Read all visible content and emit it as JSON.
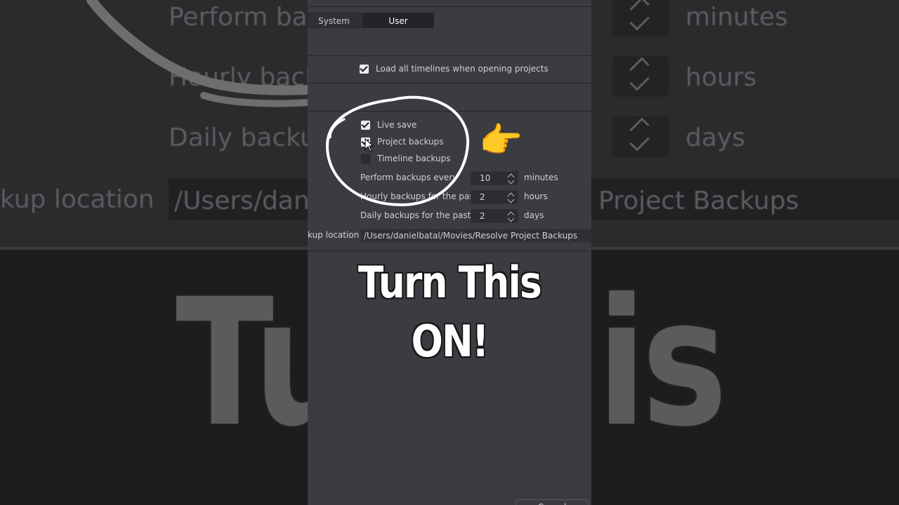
{
  "background": {
    "rows": [
      {
        "label": "Perform bac",
        "unit": "minutes"
      },
      {
        "label": "Hourly back",
        "unit": "hours"
      },
      {
        "label": "Daily backu",
        "unit": "days"
      }
    ],
    "location_label": "kup location",
    "path_left": "/Users/dan",
    "path_right": "Project Backups",
    "huge_left": "Tu",
    "huge_right": "is"
  },
  "tabs": {
    "system": "System",
    "user": "User"
  },
  "load_timelines": {
    "label": "Load all timelines when opening projects",
    "checked": true
  },
  "live_save": {
    "label": "Live save",
    "checked": true
  },
  "project_backups": {
    "label": "Project backups",
    "checked": true
  },
  "timeline_backups": {
    "label": "Timeline backups",
    "checked": false
  },
  "perform_every": {
    "label": "Perform backups every",
    "value": "10",
    "unit": "minutes"
  },
  "hourly": {
    "label": "Hourly backups for the past",
    "value": "2",
    "unit": "hours"
  },
  "daily": {
    "label": "Daily backups for the past",
    "value": "2",
    "unit": "days"
  },
  "location": {
    "label": "kup location",
    "path": "/Users/danielbatal/Movies/Resolve Project Backups"
  },
  "cancel_label": "Cancel",
  "overlay": {
    "line1": "Turn This",
    "line2": "ON!"
  },
  "colors": {
    "panel": "#3a3c41",
    "annotation": "#ffffff"
  },
  "icons": {
    "pointer": "backhand-index-pointing-right-icon",
    "cursor": "mouse-cursor-icon"
  }
}
